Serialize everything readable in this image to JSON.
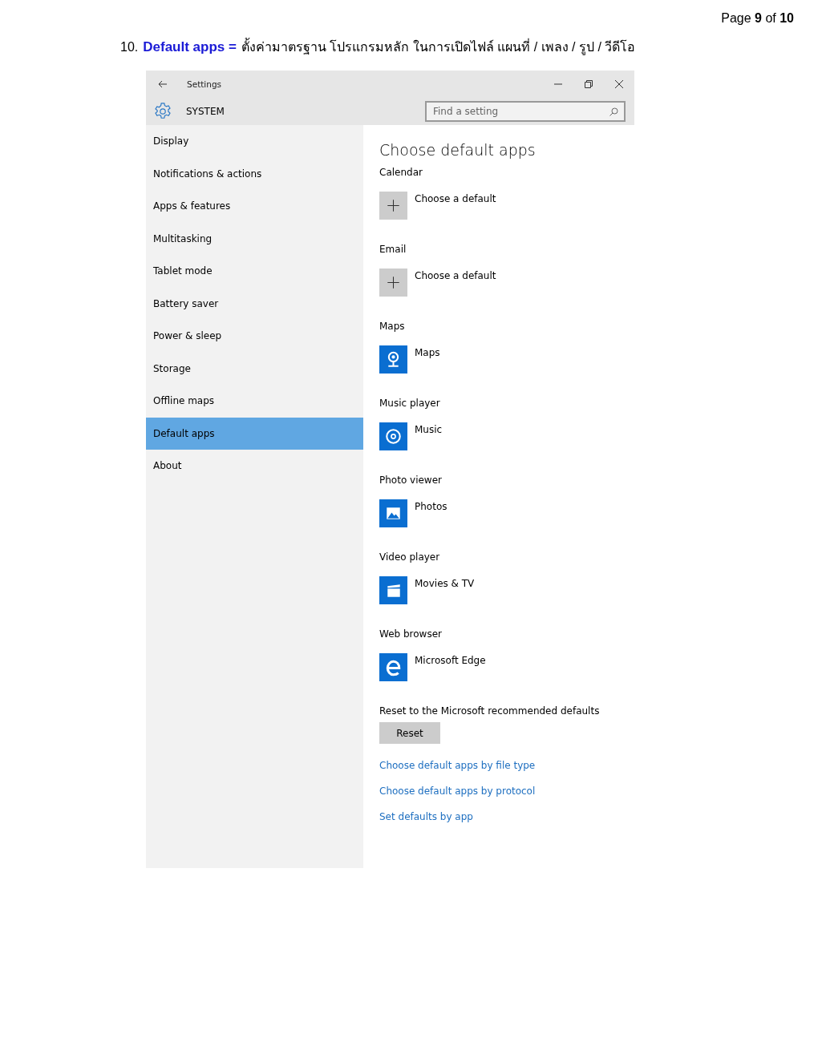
{
  "page_number": "Page **9** of **10**",
  "heading": {
    "number": "10.",
    "title": "Default apps =",
    "description": "ตั้งค่ามาตรฐาน โปรแกรมหลัก ในการเปิดไฟล์ แผนที่ / เพลง / รูป / วีดีโอ"
  },
  "window": {
    "title": "Settings",
    "section": "SYSTEM",
    "search": {
      "placeholder": "Find a setting"
    }
  },
  "sidebar": {
    "items": [
      {
        "label": "Display",
        "selected": false
      },
      {
        "label": "Notifications & actions",
        "selected": false
      },
      {
        "label": "Apps & features",
        "selected": false
      },
      {
        "label": "Multitasking",
        "selected": false
      },
      {
        "label": "Tablet mode",
        "selected": false
      },
      {
        "label": "Battery saver",
        "selected": false
      },
      {
        "label": "Power & sleep",
        "selected": false
      },
      {
        "label": "Storage",
        "selected": false
      },
      {
        "label": "Offline maps",
        "selected": false
      },
      {
        "label": "Default apps",
        "selected": true
      },
      {
        "label": "About",
        "selected": false
      }
    ]
  },
  "content": {
    "title": "Choose default apps",
    "defaults": [
      {
        "category": "Calendar",
        "app": "Choose a default",
        "kind": "empty"
      },
      {
        "category": "Email",
        "app": "Choose a default",
        "kind": "empty"
      },
      {
        "category": "Maps",
        "app": "Maps",
        "kind": "maps"
      },
      {
        "category": "Music player",
        "app": "Music",
        "kind": "music"
      },
      {
        "category": "Photo viewer",
        "app": "Photos",
        "kind": "photos"
      },
      {
        "category": "Video player",
        "app": "Movies & TV",
        "kind": "video"
      },
      {
        "category": "Web browser",
        "app": "Microsoft Edge",
        "kind": "browser"
      }
    ],
    "reset_label": "Reset to the Microsoft recommended defaults",
    "reset_button": "Reset",
    "links": [
      "Choose default apps by file type",
      "Choose default apps by protocol",
      "Set defaults by app"
    ]
  }
}
